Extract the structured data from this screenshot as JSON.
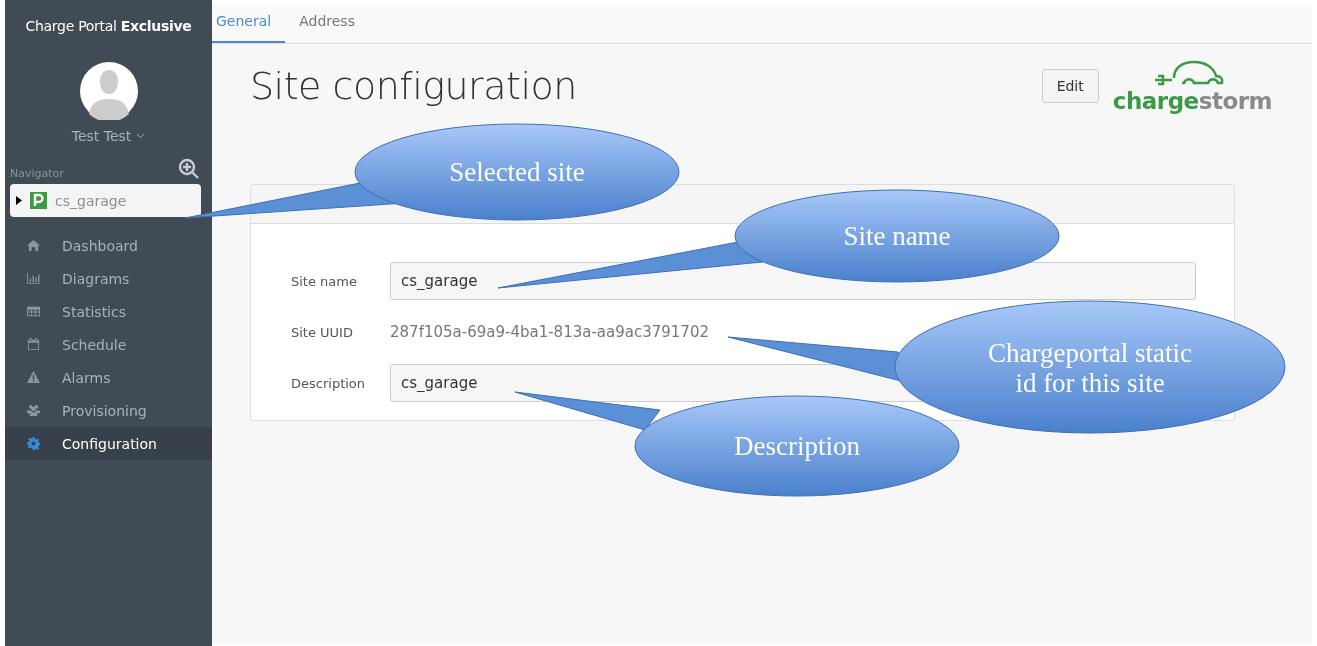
{
  "sidebar": {
    "brand": {
      "name": "Charge Portal",
      "edition": "Exclusive"
    },
    "user": {
      "name": "Test Test"
    },
    "navigator": {
      "label": "Navigator",
      "site": {
        "name": "cs_garage",
        "expanded": false
      }
    },
    "items": [
      {
        "label": "Dashboard",
        "selected": false
      },
      {
        "label": "Diagrams",
        "selected": false
      },
      {
        "label": "Statistics",
        "selected": false
      },
      {
        "label": "Schedule",
        "selected": false
      },
      {
        "label": "Alarms",
        "selected": false
      },
      {
        "label": "Provisioning",
        "selected": false
      },
      {
        "label": "Configuration",
        "selected": true
      }
    ]
  },
  "tabs": [
    {
      "label": "General",
      "selected": true
    },
    {
      "label": "Address",
      "selected": false
    }
  ],
  "page": {
    "title": "Site configuration",
    "edit_button": "Edit",
    "logo": {
      "primary": "charge",
      "secondary": "storm"
    }
  },
  "form": {
    "fields": [
      {
        "label": "Site name",
        "kind": "input",
        "value": "cs_garage"
      },
      {
        "label": "Site UUID",
        "kind": "static",
        "value": "287f105a-69a9-4ba1-813a-aa9ac3791702"
      },
      {
        "label": "Description",
        "kind": "input",
        "value": "cs_garage"
      }
    ]
  },
  "callouts": [
    {
      "lines": [
        "Selected site"
      ]
    },
    {
      "lines": [
        "Site name"
      ]
    },
    {
      "lines": [
        "Chargeportal static",
        "id for this site"
      ]
    },
    {
      "lines": [
        "Description"
      ]
    }
  ]
}
